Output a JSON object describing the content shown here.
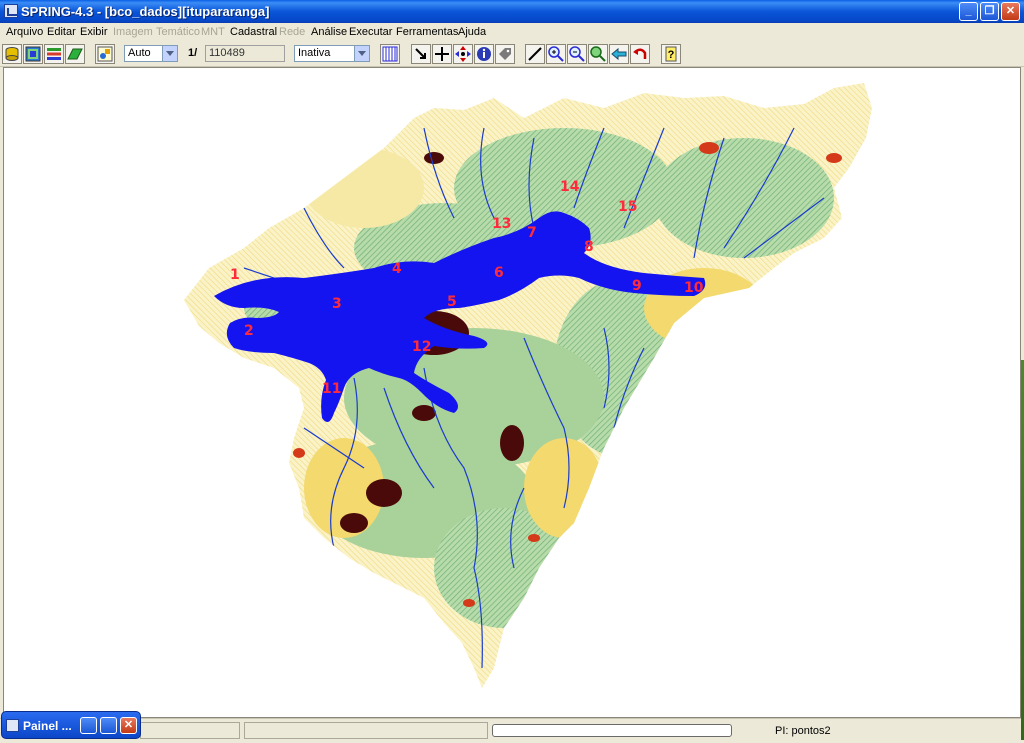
{
  "window": {
    "title": "SPRING-4.3 - [bco_dados][itupararanga]"
  },
  "menu": [
    "Arquivo",
    "Editar",
    "Exibir",
    "Imagem",
    "Temático",
    "MNT",
    "Cadastral",
    "Rede",
    "Análise",
    "Executar",
    "Ferramentas",
    "Ajuda"
  ],
  "menu_disabled": [
    "Imagem",
    "Temático",
    "MNT",
    "Rede"
  ],
  "toolbar": {
    "zoom_mode": "Auto",
    "scale_prefix": "1/",
    "scale_value": "110489",
    "cursor_mode": "Inativa"
  },
  "map": {
    "point_labels": [
      "1",
      "2",
      "3",
      "4",
      "5",
      "6",
      "7",
      "8",
      "9",
      "10",
      "11",
      "12",
      "13",
      "14",
      "15"
    ]
  },
  "status": {
    "pi": "PI: pontos2"
  },
  "taskbar": {
    "label": "Painel ..."
  },
  "colors": {
    "water": "#1414f0",
    "river": "#1a3ccc",
    "vegetation": "#9ccb8f",
    "field": "#f4e37a",
    "urban": "#4a0a0a",
    "soil": "#d43a1a",
    "label": "#ff2b3a"
  }
}
